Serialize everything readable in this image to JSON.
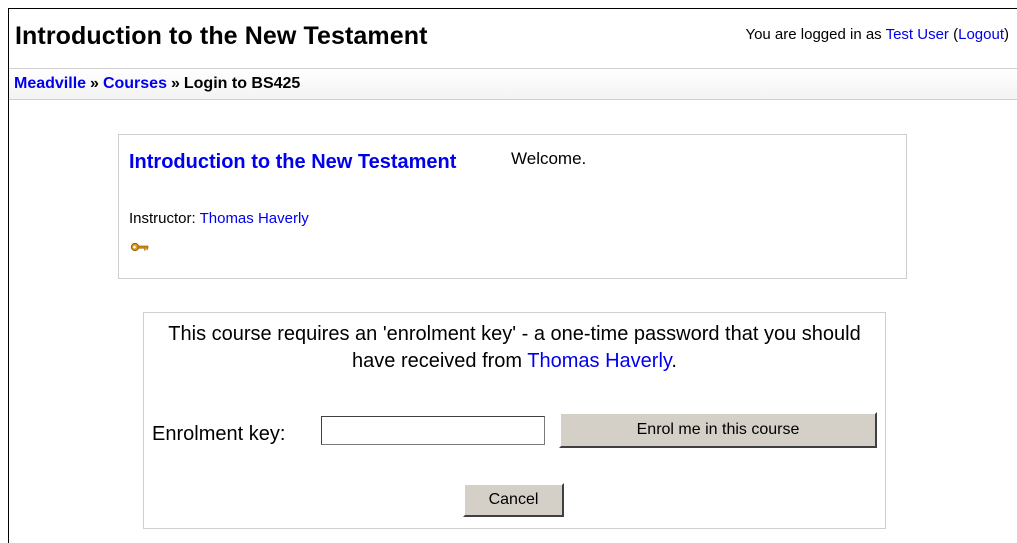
{
  "header": {
    "title": "Introduction to the New Testament",
    "login_prefix": "You are logged in as ",
    "user_name": "Test User",
    "logout_open": " (",
    "logout_label": "Logout",
    "logout_close": ")"
  },
  "breadcrumb": {
    "items": [
      "Meadville",
      "Courses",
      "Login to BS425"
    ],
    "separator": "»"
  },
  "course": {
    "name": "Introduction to the New Testament",
    "instructor_label": "Instructor:",
    "instructor_name": "Thomas Haverly",
    "summary": "Welcome.",
    "icon": "key-icon"
  },
  "enrol": {
    "message_pre": "This course requires an 'enrolment key' - a one-time password that you should have received from ",
    "message_link": "Thomas Haverly",
    "message_post": ".",
    "key_label": "Enrolment key:",
    "key_value": "",
    "submit_label": "Enrol me in this course",
    "cancel_label": "Cancel"
  },
  "colors": {
    "link": "#0000ee",
    "button_face": "#d4d0c8",
    "box_border": "#cfcfcf"
  }
}
